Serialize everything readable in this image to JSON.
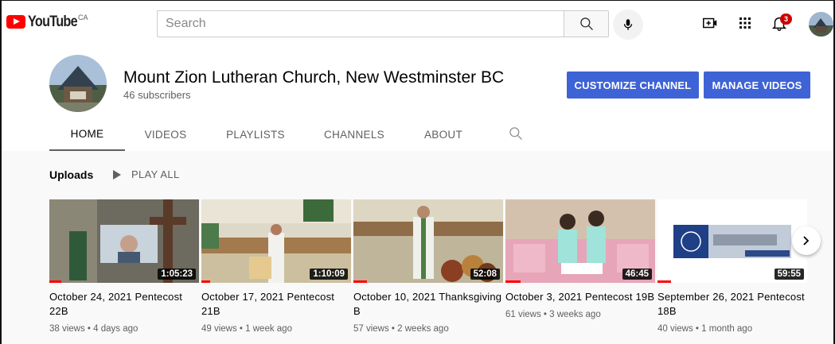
{
  "header": {
    "logo_text": "YouTube",
    "logo_region": "CA",
    "search_placeholder": "Search",
    "notification_count": "3",
    "icons": [
      "search-icon",
      "mic-icon",
      "create-video-icon",
      "apps-icon",
      "bell-icon",
      "avatar"
    ]
  },
  "channel": {
    "name": "Mount Zion Lutheran Church, New Westminster BC",
    "subscribers": "46 subscribers",
    "customize_label": "CUSTOMIZE CHANNEL",
    "manage_label": "MANAGE VIDEOS",
    "tabs": [
      {
        "label": "HOME",
        "active": true
      },
      {
        "label": "VIDEOS",
        "active": false
      },
      {
        "label": "PLAYLISTS",
        "active": false
      },
      {
        "label": "CHANNELS",
        "active": false
      },
      {
        "label": "ABOUT",
        "active": false
      }
    ]
  },
  "uploads": {
    "title": "Uploads",
    "play_all_label": "PLAY ALL",
    "videos": [
      {
        "title": "October 24, 2021 Pentecost 22B",
        "duration": "1:05:23",
        "meta": "38 views • 4 days ago",
        "watched": 0.08
      },
      {
        "title": "October 17, 2021 Pentecost 21B",
        "duration": "1:10:09",
        "meta": "49 views • 1 week ago",
        "watched": 0.06
      },
      {
        "title": "October 10, 2021 Thanksgiving B",
        "duration": "52:08",
        "meta": "57 views • 2 weeks ago",
        "watched": 0.09
      },
      {
        "title": "October 3, 2021 Pentecost 19B",
        "duration": "46:45",
        "meta": "61 views • 3 weeks ago",
        "watched": 0.1
      },
      {
        "title": "September 26, 2021 Pentecost 18B",
        "duration": "59:55",
        "meta": "40 views • 1 month ago",
        "watched": 0.09
      }
    ]
  },
  "colors": {
    "brand_red": "#ff0000",
    "button_blue": "#3e63d6"
  }
}
